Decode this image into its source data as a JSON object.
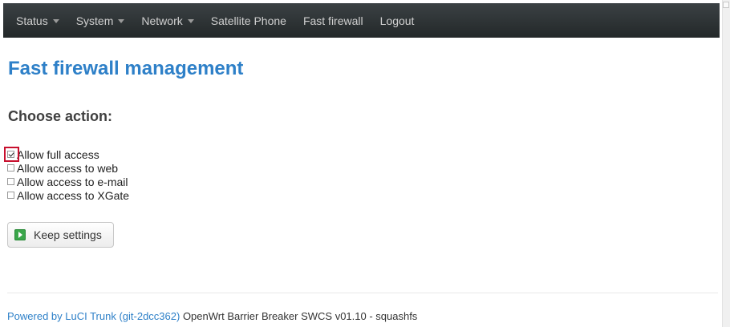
{
  "nav": {
    "items": [
      {
        "label": "Status",
        "dropdown": true
      },
      {
        "label": "System",
        "dropdown": true
      },
      {
        "label": "Network",
        "dropdown": true
      },
      {
        "label": "Satellite Phone",
        "dropdown": false
      },
      {
        "label": "Fast firewall",
        "dropdown": false
      },
      {
        "label": "Logout",
        "dropdown": false
      }
    ]
  },
  "page": {
    "title": "Fast firewall management",
    "section_title": "Choose action:"
  },
  "options": [
    {
      "label": "Allow full access",
      "checked": true
    },
    {
      "label": "Allow access to web",
      "checked": false
    },
    {
      "label": "Allow access to e-mail",
      "checked": false
    },
    {
      "label": "Allow access to XGate",
      "checked": false
    }
  ],
  "actions": {
    "keep_label": "Keep settings",
    "keep_icon": "play-icon"
  },
  "footer": {
    "link_text": "Powered by LuCI Trunk (git-2dcc362)",
    "version_text": " OpenWrt Barrier Breaker SWCS v01.10 - squashfs"
  },
  "colors": {
    "accent": "#2e80c8",
    "navbar": "#2e3436",
    "highlight": "#c8102e",
    "button_icon": "#3aa64a"
  }
}
